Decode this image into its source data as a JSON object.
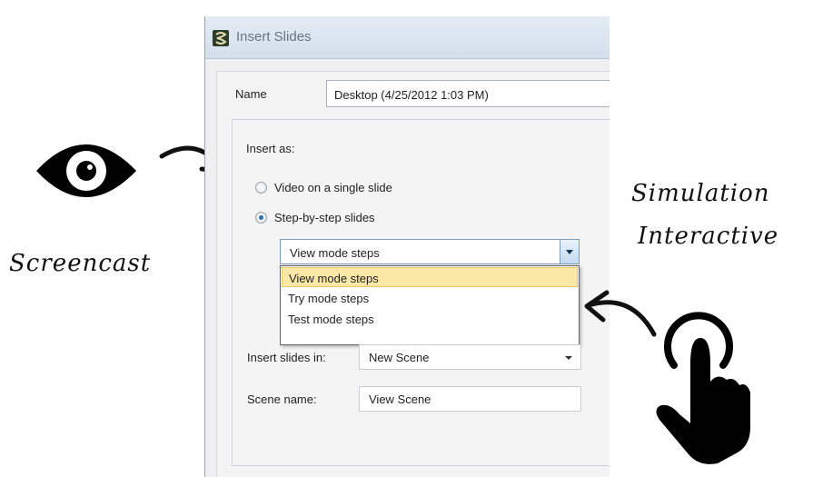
{
  "annotations": {
    "left_caption": "Screencast",
    "right_caption_1": "Simulation",
    "right_caption_2": "Interactive"
  },
  "dialog": {
    "title": "Insert Slides",
    "name_label": "Name",
    "name_value": "Desktop (4/25/2012 1:03 PM)",
    "insert_as_label": "Insert as:",
    "radio_video": "Video on a single slide",
    "radio_step": "Step-by-step slides",
    "selected_radio": "Step-by-step slides",
    "mode_select_value": "View mode steps",
    "mode_options": [
      "View mode steps",
      "Try mode steps",
      "Test mode steps"
    ],
    "highlighted_option": "View mode steps",
    "insert_slides_in_label": "Insert slides in:",
    "insert_slides_in_value": "New Scene",
    "scene_name_label": "Scene name:",
    "scene_name_value": "View Scene"
  },
  "icons": {
    "eye": "eye-icon",
    "hand": "pointing-hand-icon",
    "arrow_left": "curved-arrow-right-icon",
    "arrow_right": "curved-arrow-left-icon",
    "app": "app-icon"
  }
}
